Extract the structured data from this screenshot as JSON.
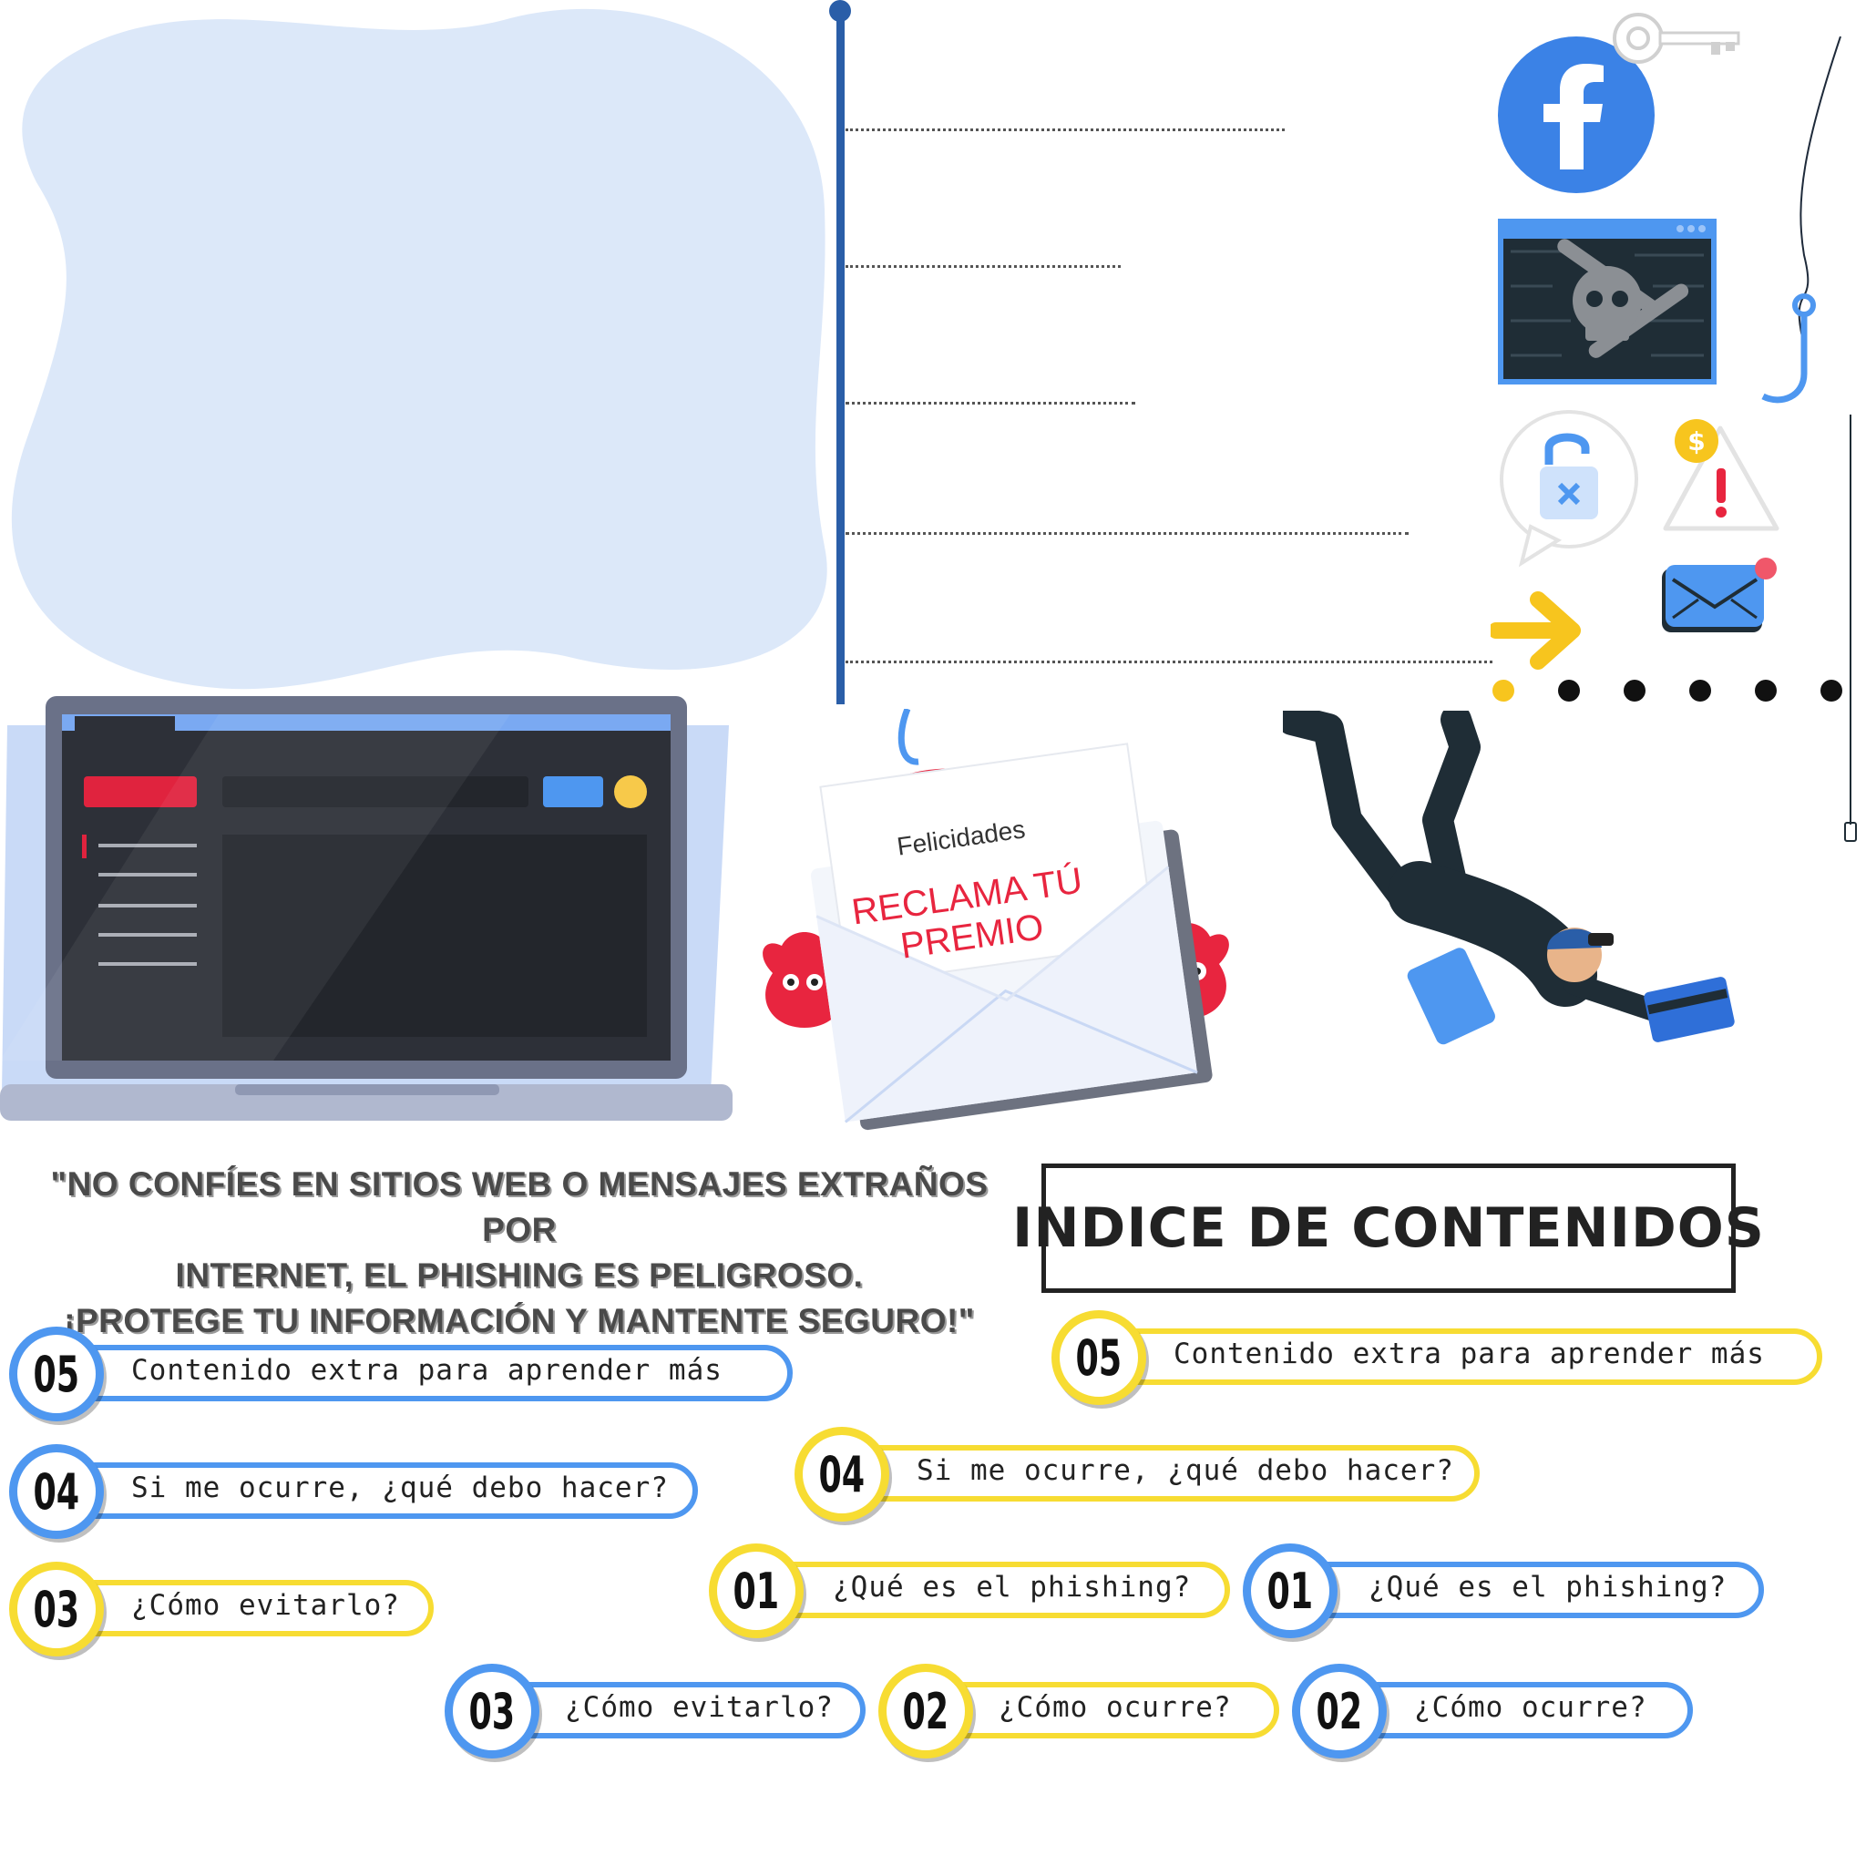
{
  "quote": {
    "line1": "\"NO CONFÍES EN SITIOS WEB O MENSAJES EXTRAÑOS POR",
    "line2": "INTERNET, EL PHISHING ES PELIGROSO.",
    "line3": "¡PROTEGE TU INFORMACIÓN Y MANTENTE SEGURO!\""
  },
  "index_title": "INDICE DE CONTENIDOS",
  "envelope": {
    "greeting": "Felicidades",
    "line1": "RECLAMA TÚ",
    "line2": "PREMIO"
  },
  "icons": {
    "logo": "facebook-icon",
    "browser": "skull-browser-icon",
    "lock": "unlocked-padlock-icon",
    "warning": "money-warning-icon",
    "mail": "envelope-notification-icon",
    "arrow": "arrow-right-icon",
    "key": "key-icon",
    "hook": "fishing-hook-icon"
  },
  "colors": {
    "blue": "#4e97f0",
    "yellow": "#f7dc32",
    "blob": "#dce8f9",
    "red": "#e8253f"
  },
  "items": [
    {
      "num": "05",
      "label": "Contenido extra para aprender más",
      "color": "blue"
    },
    {
      "num": "04",
      "label": "Si me ocurre, ¿qué debo hacer?",
      "color": "blue"
    },
    {
      "num": "03",
      "label": "¿Cómo evitarlo?",
      "color": "yellow"
    },
    {
      "num": "05",
      "label": "Contenido extra para aprender más",
      "color": "yellow"
    },
    {
      "num": "04",
      "label": "Si me ocurre, ¿qué debo hacer?",
      "color": "yellow"
    },
    {
      "num": "01",
      "label": "¿Qué es el phishing?",
      "color": "yellow"
    },
    {
      "num": "01",
      "label": "¿Qué es el phishing?",
      "color": "blue"
    },
    {
      "num": "03",
      "label": "¿Cómo evitarlo?",
      "color": "blue"
    },
    {
      "num": "02",
      "label": "¿Cómo ocurre?",
      "color": "yellow"
    },
    {
      "num": "02",
      "label": "¿Cómo ocurre?",
      "color": "blue"
    }
  ]
}
